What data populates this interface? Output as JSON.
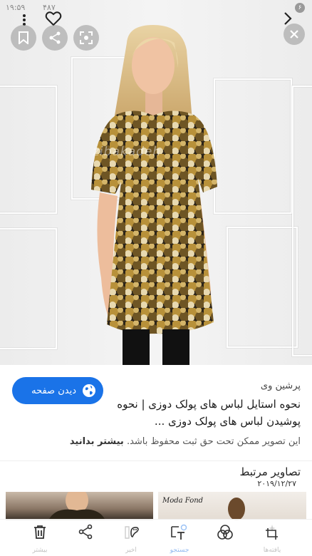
{
  "status_bar": {
    "time": "۱۹:۵۹",
    "signal_text": "۴۸۷ ",
    "badge": "۶"
  },
  "viewer": {
    "watermark": "zibakadeh",
    "top_icons": [
      "more-vert-icon",
      "heart-icon",
      "chevron-right-icon"
    ],
    "buttons": [
      "bookmark-icon",
      "share-icon",
      "lens-icon",
      "close-icon"
    ]
  },
  "card": {
    "source": "پرشین وی",
    "title": "نحوه استایل لباس های پولک دوزی | نحوه پوشیدن لباس های پولک دوزی ...",
    "visit_label": "دیدن صفحه",
    "copyright_text": "این تصویر ممکن تحت حق ثبت محفوظ باشد.",
    "copyright_link": "بیشتر بدانید",
    "related_title": "تصاویر مرتبط",
    "related_date": "۲۰۱۹/۱۲/۲۷",
    "related_thumb_text": "Moda Fond"
  },
  "toolbar": {
    "items": [
      {
        "label": "بیشتر",
        "icon": "trash-icon"
      },
      {
        "label": "",
        "icon": "share-icon"
      },
      {
        "label": "اخیر",
        "icon": "palette-icon"
      },
      {
        "label": "جستجو",
        "icon": "text-select-icon"
      },
      {
        "label": "",
        "icon": "circles-icon"
      },
      {
        "label": "یافته‌ها",
        "icon": "crop-icon"
      }
    ]
  },
  "colors": {
    "accent": "#1a73e8",
    "dress_gold": "#b8913a",
    "dress_dark": "#2c2418"
  }
}
